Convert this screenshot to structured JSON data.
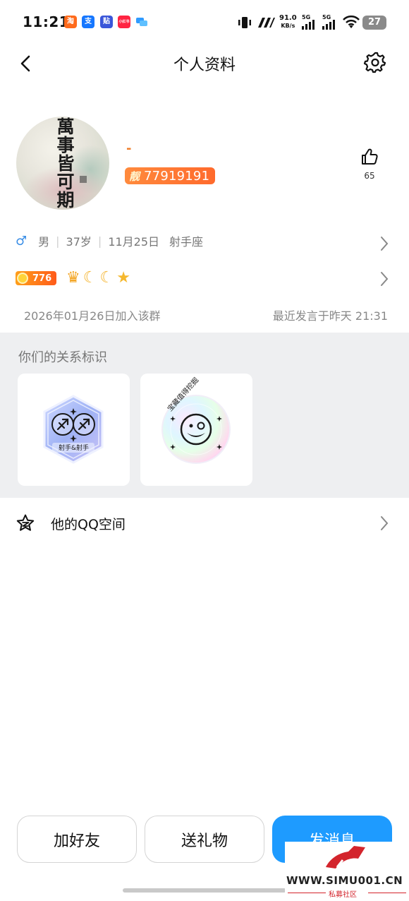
{
  "status_bar": {
    "time": "11:21",
    "apps": [
      {
        "name": "taobao",
        "glyph": "淘",
        "color": "#ff6a1b"
      },
      {
        "name": "alipay",
        "glyph": "支",
        "color": "#1677ff"
      },
      {
        "name": "tieba",
        "glyph": "贴",
        "color": "#3a56d9"
      },
      {
        "name": "xiaohongshu",
        "glyph": "小红书",
        "color": "#ff2442"
      },
      {
        "name": "message",
        "glyph": "",
        "color": "#2f9bff"
      }
    ],
    "network_speed_value": "91.0",
    "network_speed_unit": "KB/s",
    "sim1": "5G",
    "sim2": "5G",
    "battery": "27"
  },
  "header": {
    "title": "个人资料"
  },
  "profile": {
    "nickname": "-",
    "avatar_text": "萬事皆可期",
    "badge_label": "靓",
    "qq_number": "77919191",
    "like_count": "65"
  },
  "info": {
    "gender": "男",
    "age": "37岁",
    "birthday": "11月25日",
    "zodiac": "射手座"
  },
  "level": {
    "points": "776"
  },
  "group": {
    "join_text": "2026年01月26日加入该群",
    "last_speak": "最近发言于昨天 21:31"
  },
  "relation": {
    "title": "你们的关系标识",
    "badges": [
      {
        "label": "射手&射手"
      },
      {
        "label": "宝藏值得挖掘"
      }
    ]
  },
  "qzone": {
    "label": "他的QQ空间"
  },
  "actions": {
    "add_friend": "加好友",
    "send_gift": "送礼物",
    "send_message": "发消息"
  },
  "watermark": {
    "url": "WWW.SIMU001.CN",
    "sub": "私募社区"
  }
}
